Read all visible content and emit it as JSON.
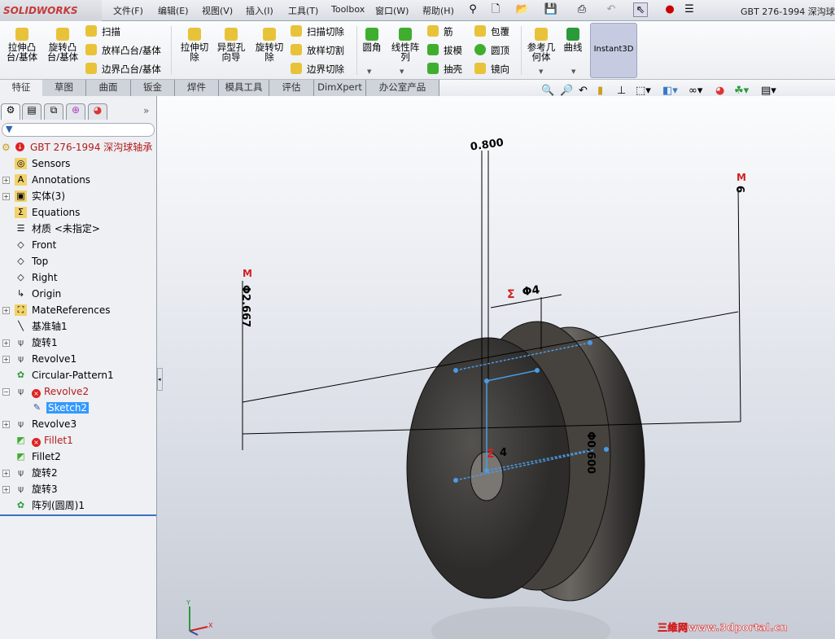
{
  "app": {
    "brand": "SOLIDWORKS",
    "document_title": "GBT 276-1994 深沟球轴"
  },
  "menu": [
    "文件(F)",
    "编辑(E)",
    "视图(V)",
    "插入(I)",
    "工具(T)",
    "Toolbox",
    "窗口(W)",
    "帮助(H)"
  ],
  "ribbon": {
    "big": [
      {
        "label": "拉伸凸台/基体",
        "color": "#e8c33a"
      },
      {
        "label": "旋转凸台/基体",
        "color": "#e8c33a"
      },
      {
        "label": "拉伸切除",
        "color": "#e8c33a"
      },
      {
        "label": "异型孔向导",
        "color": "#e8c33a"
      },
      {
        "label": "旋转切除",
        "color": "#e8c33a"
      },
      {
        "label": "圆角",
        "color": "#3fae2f"
      },
      {
        "label": "线性阵列",
        "color": "#3fae2f"
      },
      {
        "label": "参考几何体",
        "color": "#e8c33a"
      },
      {
        "label": "曲线",
        "color": "#2a9a3a"
      }
    ],
    "small": [
      "扫描",
      "放样凸台/基体",
      "边界凸台/基体",
      "扫描切除",
      "放样切割",
      "边界切除",
      "筋",
      "拔模",
      "抽壳",
      "包覆",
      "圆顶",
      "镜向"
    ],
    "instant3d": "Instant3D"
  },
  "tabs": [
    "特征",
    "草图",
    "曲面",
    "钣金",
    "焊件",
    "模具工具",
    "评估",
    "DimXpert",
    "办公室产品"
  ],
  "active_tab": "特征",
  "tree": {
    "root": "GBT 276-1994 深沟球轴承",
    "items": [
      {
        "label": "Sensors",
        "icon": "sensor-folder-icon"
      },
      {
        "label": "Annotations",
        "icon": "annotations-folder-icon"
      },
      {
        "label": "实体(3)",
        "icon": "solid-bodies-folder-icon"
      },
      {
        "label": "Equations",
        "icon": "equations-folder-icon"
      },
      {
        "label": "材质 <未指定>",
        "icon": "material-icon"
      },
      {
        "label": "Front",
        "icon": "plane-icon"
      },
      {
        "label": "Top",
        "icon": "plane-icon"
      },
      {
        "label": "Right",
        "icon": "plane-icon"
      },
      {
        "label": "Origin",
        "icon": "origin-icon"
      },
      {
        "label": "MateReferences",
        "icon": "mate-references-icon"
      },
      {
        "label": "基准轴1",
        "icon": "axis-icon"
      },
      {
        "label": "旋转1",
        "icon": "revolve-icon"
      },
      {
        "label": "Revolve1",
        "icon": "revolve-icon"
      },
      {
        "label": "Circular-Pattern1",
        "icon": "circular-pattern-icon"
      },
      {
        "label": "Revolve2",
        "icon": "revolve-icon",
        "error": true
      },
      {
        "label": "Sketch2",
        "icon": "sketch-icon",
        "selected": true
      },
      {
        "label": "Revolve3",
        "icon": "revolve-icon"
      },
      {
        "label": "Fillet1",
        "icon": "fillet-icon",
        "error": true
      },
      {
        "label": "Fillet2",
        "icon": "fillet-icon"
      },
      {
        "label": "旋转2",
        "icon": "revolve-icon"
      },
      {
        "label": "旋转3",
        "icon": "revolve-icon"
      },
      {
        "label": "阵列(圆周)1",
        "icon": "circular-pattern-icon"
      }
    ]
  },
  "dimensions": {
    "top": "0.800",
    "left": "Φ2.667",
    "middle": "Φ4",
    "small": "4",
    "right": "Φ0.600",
    "far_right": "6",
    "marker": "M",
    "sigma": "Σ"
  },
  "triad": {
    "x": "X",
    "y": "Y"
  },
  "watermark": "三维网www.3dportal.cn",
  "colors": {
    "error": "#d22222",
    "selection": "#3399ff",
    "sketch": "#4a9be8",
    "model": "#3a3836"
  }
}
